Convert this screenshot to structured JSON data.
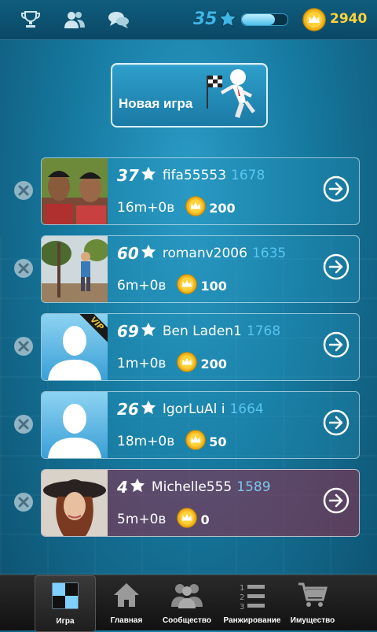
{
  "topbar": {
    "level": "35",
    "xp_fraction": 0.72,
    "coins": "2940"
  },
  "new_game": {
    "label": "Новая игра"
  },
  "games": [
    {
      "level": "37",
      "name": "fifa55553",
      "rating": "1678",
      "time_control": "16m+0в",
      "bet": "200",
      "avatar": "photo-two-men",
      "vip": false,
      "highlight": false
    },
    {
      "level": "60",
      "name": "romanv2006",
      "rating": "1635",
      "time_control": "6m+0в",
      "bet": "100",
      "avatar": "photo-man-outdoors",
      "vip": false,
      "highlight": false
    },
    {
      "level": "69",
      "name": "Ben Laden1",
      "rating": "1768",
      "time_control": "1m+0в",
      "bet": "200",
      "avatar": "default-silhouette",
      "vip": true,
      "vip_label": "VIP",
      "highlight": false
    },
    {
      "level": "26",
      "name": "IgorLuAl i",
      "rating": "1664",
      "time_control": "18m+0в",
      "bet": "50",
      "avatar": "default-silhouette",
      "vip": false,
      "highlight": false
    },
    {
      "level": "4",
      "name": "Michelle555",
      "rating": "1589",
      "time_control": "5m+0в",
      "bet": "0",
      "avatar": "photo-woman-hat",
      "vip": false,
      "highlight": true
    }
  ],
  "nav": [
    {
      "label": "Игра",
      "icon": "game-board-icon",
      "active": true
    },
    {
      "label": "Главная",
      "icon": "home-icon",
      "active": false
    },
    {
      "label": "Сообщество",
      "icon": "community-icon",
      "active": false
    },
    {
      "label": "Ранжирование",
      "icon": "ranking-icon",
      "active": false
    },
    {
      "label": "Имущество",
      "icon": "shopping-cart-icon",
      "active": false
    }
  ],
  "colors": {
    "accent": "#3fb6e6",
    "coin": "#ffd23c",
    "highlight_card": "#96284a"
  }
}
